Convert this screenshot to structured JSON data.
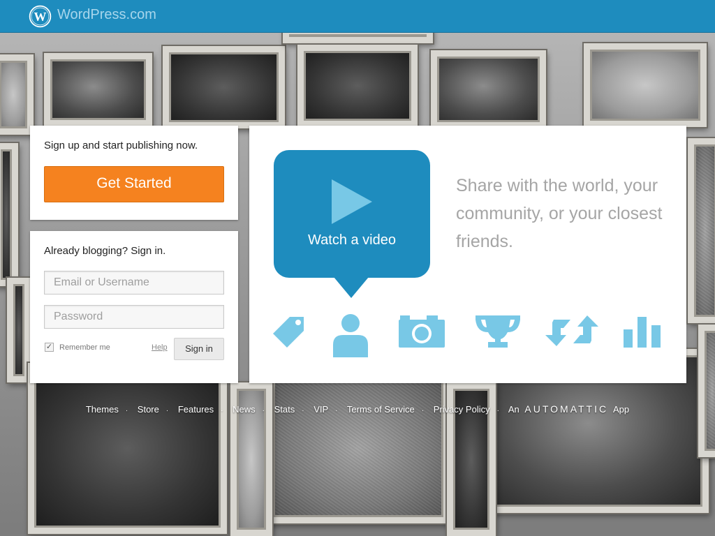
{
  "header": {
    "brand": "WordPress.com",
    "logo_icon": "wordpress-logo-icon",
    "bar_color": "#1e8cbe"
  },
  "signup": {
    "lead": "Sign up and start publishing now.",
    "button_label": "Get Started",
    "button_color": "#f5821f"
  },
  "signin": {
    "lead": "Already blogging? Sign in.",
    "username_placeholder": "Email or Username",
    "password_placeholder": "Password",
    "remember_label": "Remember me",
    "remember_checked": true,
    "help_label": "Help",
    "button_label": "Sign in"
  },
  "feature": {
    "video_label": "Watch a video",
    "tagline": "Share with the world, your community, or your closest friends.",
    "icons": [
      "tag-icon",
      "person-icon",
      "camera-icon",
      "trophy-icon",
      "repost-arrows-icon",
      "stats-bars-icon"
    ],
    "icon_color": "#78c8e6"
  },
  "footer": {
    "links": [
      "Themes",
      "Store",
      "Features",
      "News",
      "Stats",
      "VIP",
      "Terms of Service",
      "Privacy Policy"
    ],
    "automattic_prefix": "An",
    "automattic_name": "AUTOMATTIC",
    "automattic_suffix": "App"
  }
}
